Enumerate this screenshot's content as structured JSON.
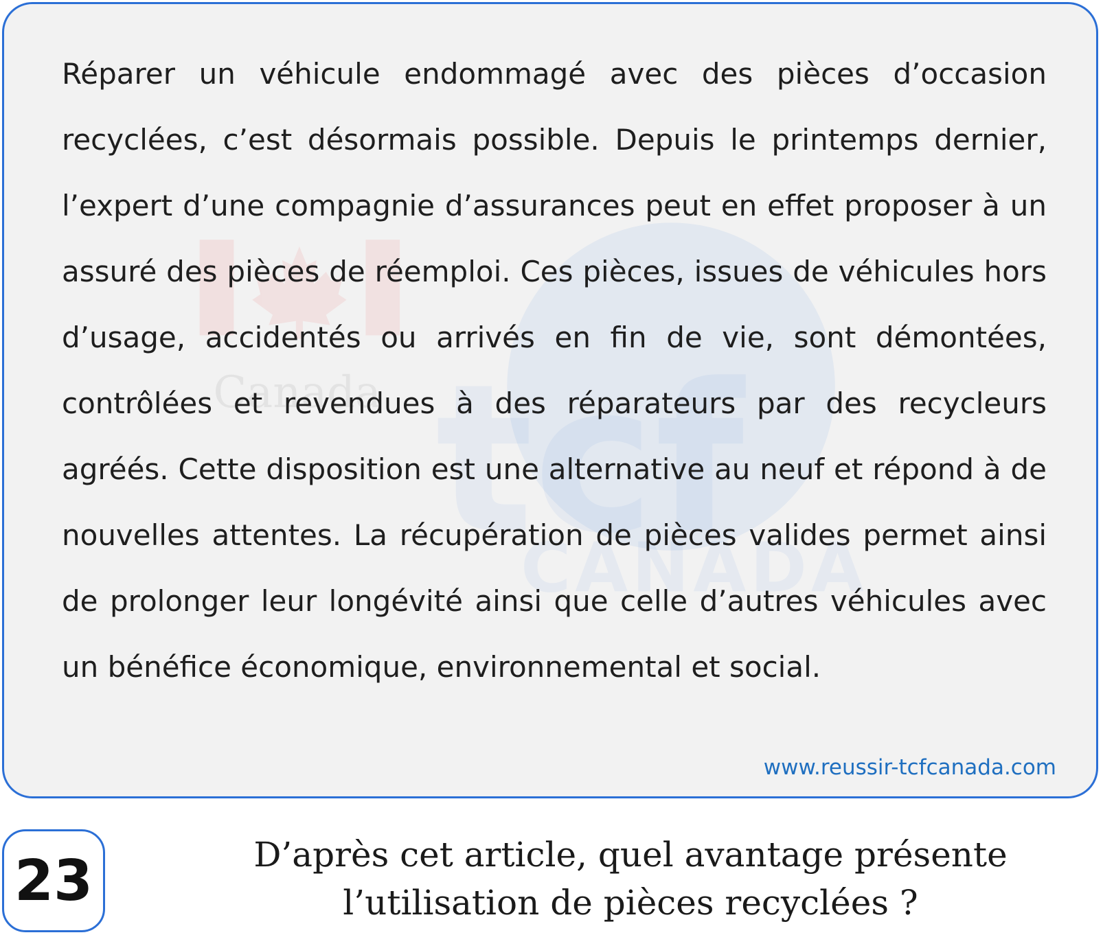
{
  "article": {
    "text": "Réparer un véhicule endommagé avec des pièces d’occasion recyclées, c’est désormais possible. Depuis le printemps dernier, l’expert d’une compagnie d’assurances peut en effet proposer à un assuré des pièces de réemploi. Ces pièces, issues de véhicules hors d’usage, accidentés ou arrivés en fin de vie, sont démontées, contrôlées et revendues à des réparateurs par des recycleurs agréés. Cette disposition est une alternative au neuf et répond à de nouvelles attentes. La récupération de pièces valides permet ainsi de prolonger leur longévité ainsi que celle d’autres véhicules avec un bénéfice économique, environnemental et social.",
    "source_url": "www.reussir-tcfcanada.com"
  },
  "watermark": {
    "logo_text": "tcf",
    "logo_subtext": "CANADA",
    "canada_wordmark": "Canada"
  },
  "question": {
    "number": "23",
    "line1": "D’après cet article, quel avantage présente",
    "line2": "l’utilisation de pièces recyclées ?"
  },
  "colors": {
    "border_blue": "#2b6fd6",
    "link_blue": "#1f6fc0",
    "box_background": "#f2f2f2",
    "flag_red": "#e8393b"
  }
}
